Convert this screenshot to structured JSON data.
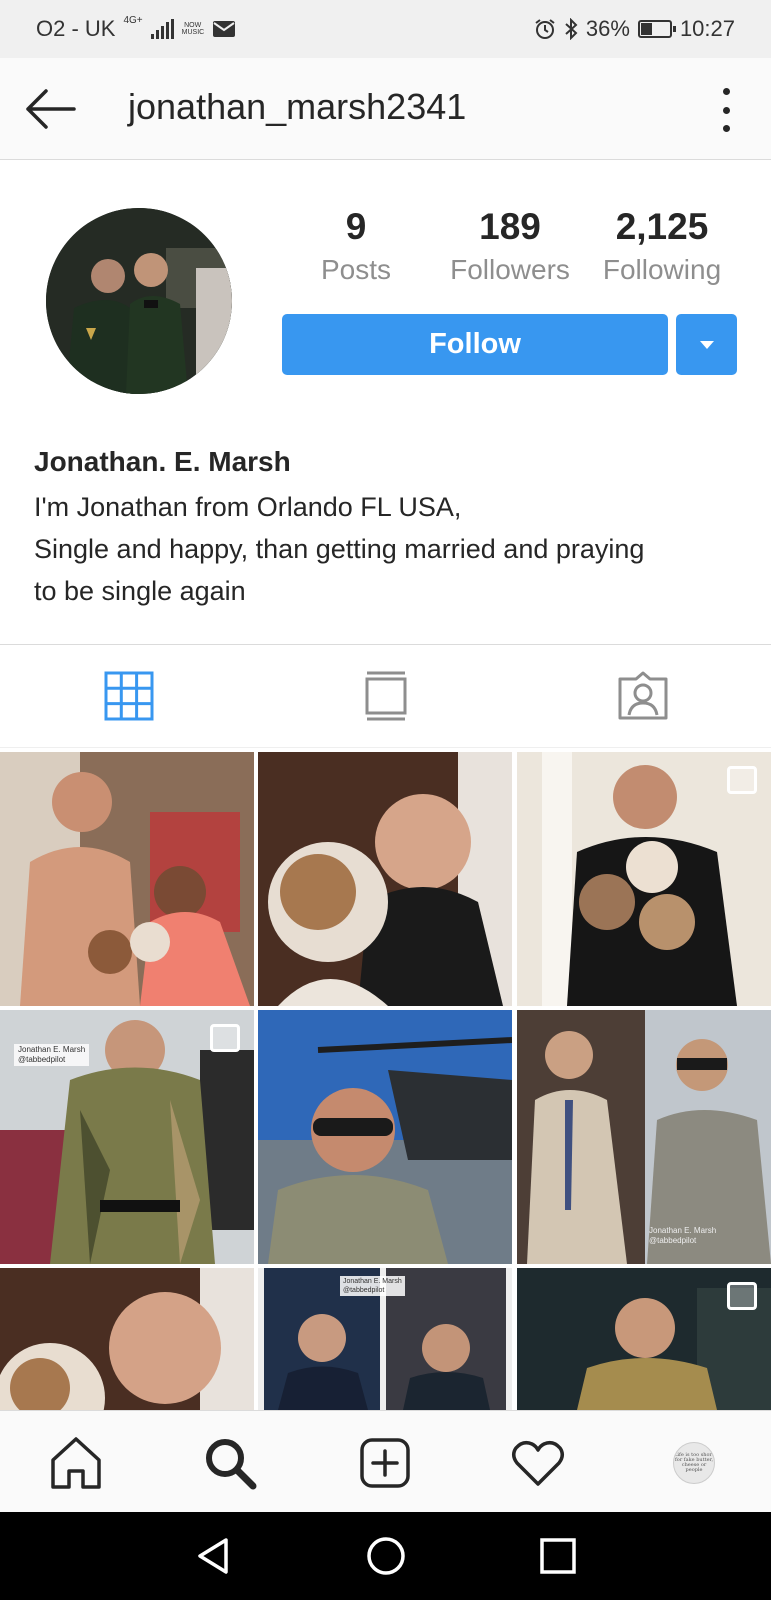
{
  "status_bar": {
    "carrier": "O2 - UK",
    "network": "4G+",
    "music_badge": "NOW MUSIC",
    "battery": "36%",
    "battery_level": 0.36,
    "time": "10:27"
  },
  "header": {
    "username": "jonathan_marsh2341"
  },
  "profile": {
    "stats": [
      {
        "value": "9",
        "label": "Posts"
      },
      {
        "value": "189",
        "label": "Followers"
      },
      {
        "value": "2,125",
        "label": "Following"
      }
    ],
    "follow_label": "Follow",
    "follow_color": "#3897f0",
    "name": "Jonathan. E. Marsh",
    "bio_lines": [
      "I'm Jonathan from Orlando FL USA,",
      "Single and happy, than getting married and praying",
      "to be single again"
    ]
  },
  "tabs": [
    "grid-icon",
    "feed-icon",
    "tagged-icon"
  ],
  "posts": [
    {
      "desc": "man-with-girl-and-puppies",
      "multi": false
    },
    {
      "desc": "selfie-with-bulldog",
      "multi": false
    },
    {
      "desc": "man-holding-puppies",
      "multi": true
    },
    {
      "desc": "camouflage-robe-store",
      "watermark": "Jonathan E. Marsh\n@tabbedpilot",
      "multi": true
    },
    {
      "desc": "aviator-sunglasses-helicopter",
      "multi": false
    },
    {
      "desc": "suit-and-uniform-collage",
      "watermark": "Jonathan E. Marsh\n@tabbedpilot",
      "multi": false
    },
    {
      "desc": "selfie-with-bulldog-crop",
      "multi": false
    },
    {
      "desc": "dress-uniform-collage",
      "watermark": "Jonathan E. Marsh\n@tabbedpilot",
      "multi": false
    },
    {
      "desc": "man-in-tshirt",
      "multi": true
    }
  ],
  "bottom_nav": {
    "items": [
      "home-icon",
      "search-icon",
      "add-post-icon",
      "heart-icon",
      "profile-avatar"
    ],
    "avatar_text": "Life is too short for fake butter, cheese or people"
  }
}
